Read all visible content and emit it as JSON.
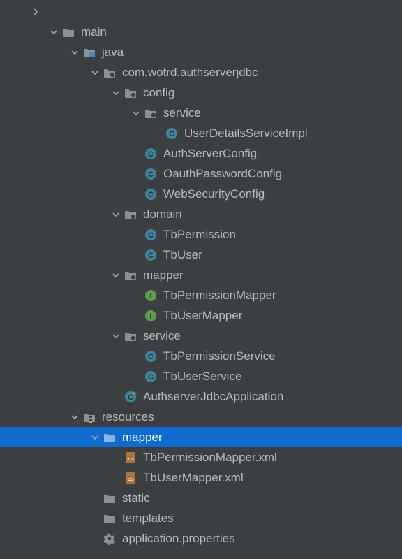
{
  "tree": [
    {
      "indent": 44,
      "chevron": "right",
      "icon": null,
      "label": "",
      "selected": false
    },
    {
      "indent": 70,
      "chevron": "down",
      "icon": "folder",
      "label": "main",
      "selected": false
    },
    {
      "indent": 100,
      "chevron": "down",
      "icon": "folder-src",
      "label": "java",
      "selected": false
    },
    {
      "indent": 129,
      "chevron": "down",
      "icon": "package",
      "label": "com.wotrd.authserverjdbc",
      "selected": false
    },
    {
      "indent": 159,
      "chevron": "down",
      "icon": "package",
      "label": "config",
      "selected": false
    },
    {
      "indent": 188,
      "chevron": "down",
      "icon": "package",
      "label": "service",
      "selected": false
    },
    {
      "indent": 218,
      "chevron": "none",
      "icon": "class",
      "label": "UserDetailsServiceImpl",
      "selected": false
    },
    {
      "indent": 188,
      "chevron": "none",
      "icon": "class",
      "label": "AuthServerConfig",
      "selected": false
    },
    {
      "indent": 188,
      "chevron": "none",
      "icon": "class",
      "label": "OauthPasswordConfig",
      "selected": false
    },
    {
      "indent": 188,
      "chevron": "none",
      "icon": "class",
      "label": "WebSecurityConfig",
      "selected": false
    },
    {
      "indent": 159,
      "chevron": "down",
      "icon": "package",
      "label": "domain",
      "selected": false
    },
    {
      "indent": 188,
      "chevron": "none",
      "icon": "class",
      "label": "TbPermission",
      "selected": false
    },
    {
      "indent": 188,
      "chevron": "none",
      "icon": "class",
      "label": "TbUser",
      "selected": false
    },
    {
      "indent": 159,
      "chevron": "down",
      "icon": "package",
      "label": "mapper",
      "selected": false
    },
    {
      "indent": 188,
      "chevron": "none",
      "icon": "interface",
      "label": "TbPermissionMapper",
      "selected": false
    },
    {
      "indent": 188,
      "chevron": "none",
      "icon": "interface",
      "label": "TbUserMapper",
      "selected": false
    },
    {
      "indent": 159,
      "chevron": "down",
      "icon": "package",
      "label": "service",
      "selected": false
    },
    {
      "indent": 188,
      "chevron": "none",
      "icon": "class",
      "label": "TbPermissionService",
      "selected": false
    },
    {
      "indent": 188,
      "chevron": "none",
      "icon": "class",
      "label": "TbUserService",
      "selected": false
    },
    {
      "indent": 159,
      "chevron": "none",
      "icon": "class-run",
      "label": "AuthserverJdbcApplication",
      "selected": false
    },
    {
      "indent": 100,
      "chevron": "down",
      "icon": "folder-resource",
      "label": "resources",
      "selected": false
    },
    {
      "indent": 129,
      "chevron": "down",
      "icon": "folder",
      "label": "mapper",
      "selected": true
    },
    {
      "indent": 159,
      "chevron": "none",
      "icon": "xml",
      "label": "TbPermissionMapper.xml",
      "selected": false
    },
    {
      "indent": 159,
      "chevron": "none",
      "icon": "xml",
      "label": "TbUserMapper.xml",
      "selected": false
    },
    {
      "indent": 129,
      "chevron": "none",
      "icon": "folder",
      "label": "static",
      "selected": false
    },
    {
      "indent": 129,
      "chevron": "none",
      "icon": "folder",
      "label": "templates",
      "selected": false
    },
    {
      "indent": 129,
      "chevron": "none",
      "icon": "properties",
      "label": "application.properties",
      "selected": false
    }
  ]
}
